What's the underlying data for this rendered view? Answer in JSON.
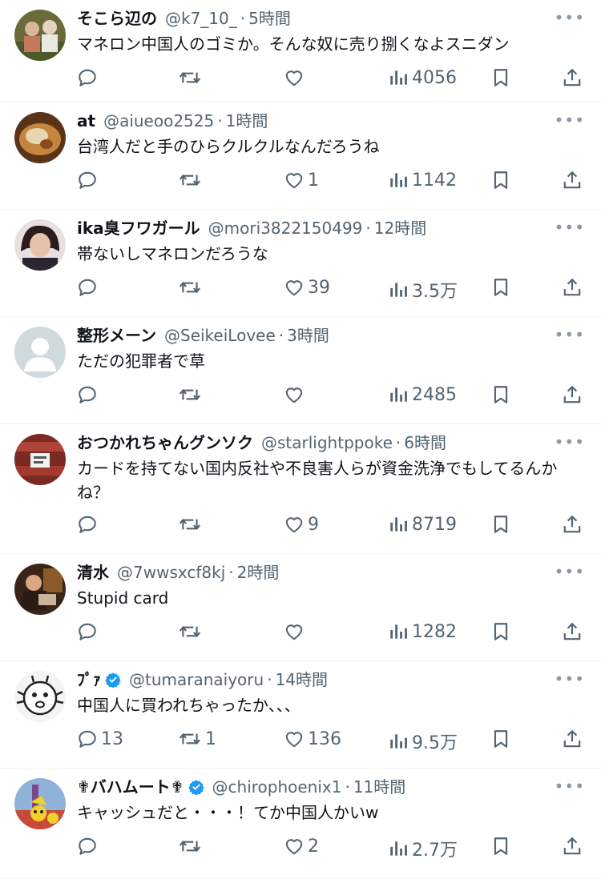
{
  "tweets": [
    {
      "name": "そこら辺の",
      "handle": "@k7_10_",
      "time": "5時間",
      "text": "マネロン中国人のゴミか。そんな奴に売り捌くなよスニダン",
      "replies": "",
      "retweets": "",
      "likes": "",
      "views": "4056",
      "verified": false
    },
    {
      "name": "at",
      "handle": "@aiueoo2525",
      "time": "1時間",
      "text": "台湾人だと手のひらクルクルなんだろうね",
      "replies": "",
      "retweets": "",
      "likes": "1",
      "views": "1142",
      "verified": false
    },
    {
      "name": "ika臭フワガール",
      "handle": "@mori3822150499",
      "time": "12時間",
      "text": "帯ないしマネロンだろうな",
      "replies": "",
      "retweets": "",
      "likes": "39",
      "views": "3.5万",
      "verified": false
    },
    {
      "name": "整形メーン",
      "handle": "@SeikeiLovee",
      "time": "3時間",
      "text": "ただの犯罪者で草",
      "replies": "",
      "retweets": "",
      "likes": "",
      "views": "2485",
      "verified": false
    },
    {
      "name": "おつかれちゃんグンソク",
      "handle": "@starlightppoke",
      "time": "6時間",
      "text": "カードを持てない国内反社や不良害人らが資金洗浄でもしてるんかね？",
      "replies": "",
      "retweets": "",
      "likes": "9",
      "views": "8719",
      "verified": false
    },
    {
      "name": "清水",
      "handle": "@7wwsxcf8kj",
      "time": "2時間",
      "text": "Stupid card",
      "replies": "",
      "retweets": "",
      "likes": "",
      "views": "1282",
      "verified": false
    },
    {
      "name": "ﾌﾟｧ",
      "handle": "@tumaranaiyoru",
      "time": "14時間",
      "text": "中国人に買われちゃったか、、、",
      "replies": "13",
      "retweets": "1",
      "likes": "136",
      "views": "9.5万",
      "verified": true
    },
    {
      "name": "✟バハムート✟",
      "handle": "@chirophoenix1",
      "time": "11時間",
      "text": "キャッシュだと・・・！てか中国人かいw",
      "replies": "",
      "retweets": "",
      "likes": "2",
      "views": "2.7万",
      "verified": true
    }
  ],
  "ui": {
    "dot": "·",
    "more": "•••"
  },
  "colors": {
    "text": "#0f1419",
    "secondary": "#536471",
    "divider": "#eff3f4",
    "verified": "#1d9bf0"
  }
}
